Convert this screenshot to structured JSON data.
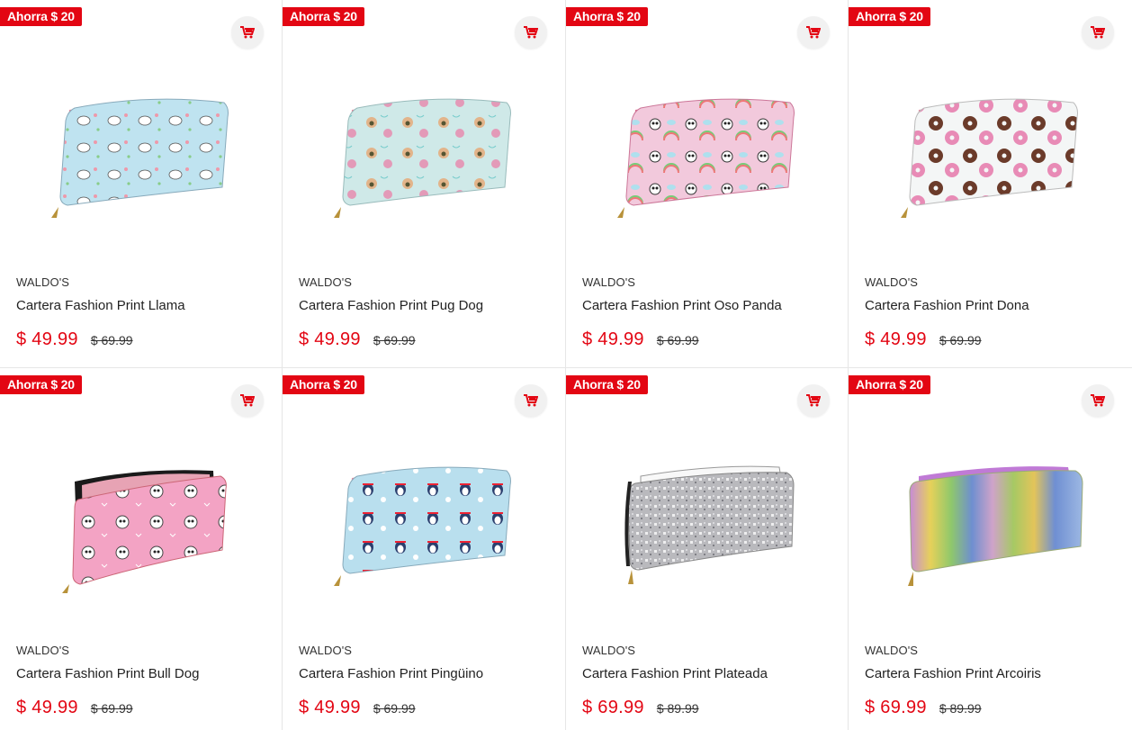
{
  "colors": {
    "accent": "#e30613"
  },
  "icons": {
    "cart": "add-to-cart-icon"
  },
  "products": [
    {
      "badge": "Ahorra $ 20",
      "brand": "WALDO'S",
      "name": "Cartera Fashion Print Llama",
      "price": "$ 49.99",
      "old_price": "$ 69.99",
      "image": "llama-wallet"
    },
    {
      "badge": "Ahorra $ 20",
      "brand": "WALDO'S",
      "name": "Cartera Fashion Print Pug Dog",
      "price": "$ 49.99",
      "old_price": "$ 69.99",
      "image": "pug-wallet"
    },
    {
      "badge": "Ahorra $ 20",
      "brand": "WALDO'S",
      "name": "Cartera Fashion Print Oso Panda",
      "price": "$ 49.99",
      "old_price": "$ 69.99",
      "image": "panda-wallet"
    },
    {
      "badge": "Ahorra $ 20",
      "brand": "WALDO'S",
      "name": "Cartera Fashion Print Dona",
      "price": "$ 49.99",
      "old_price": "$ 69.99",
      "image": "donut-wallet"
    },
    {
      "badge": "Ahorra $ 20",
      "brand": "WALDO'S",
      "name": "Cartera Fashion Print Bull Dog",
      "price": "$ 49.99",
      "old_price": "$ 69.99",
      "image": "bulldog-wallet"
    },
    {
      "badge": "Ahorra $ 20",
      "brand": "WALDO'S",
      "name": "Cartera Fashion Print Pingüino",
      "price": "$ 49.99",
      "old_price": "$ 69.99",
      "image": "penguin-wallet"
    },
    {
      "badge": "Ahorra $ 20",
      "brand": "WALDO'S",
      "name": "Cartera Fashion Print Plateada",
      "price": "$ 69.99",
      "old_price": "$ 89.99",
      "image": "silver-glitter-wallet"
    },
    {
      "badge": "Ahorra $ 20",
      "brand": "WALDO'S",
      "name": "Cartera Fashion Print Arcoiris",
      "price": "$ 69.99",
      "old_price": "$ 89.99",
      "image": "rainbow-glitter-wallet"
    }
  ]
}
